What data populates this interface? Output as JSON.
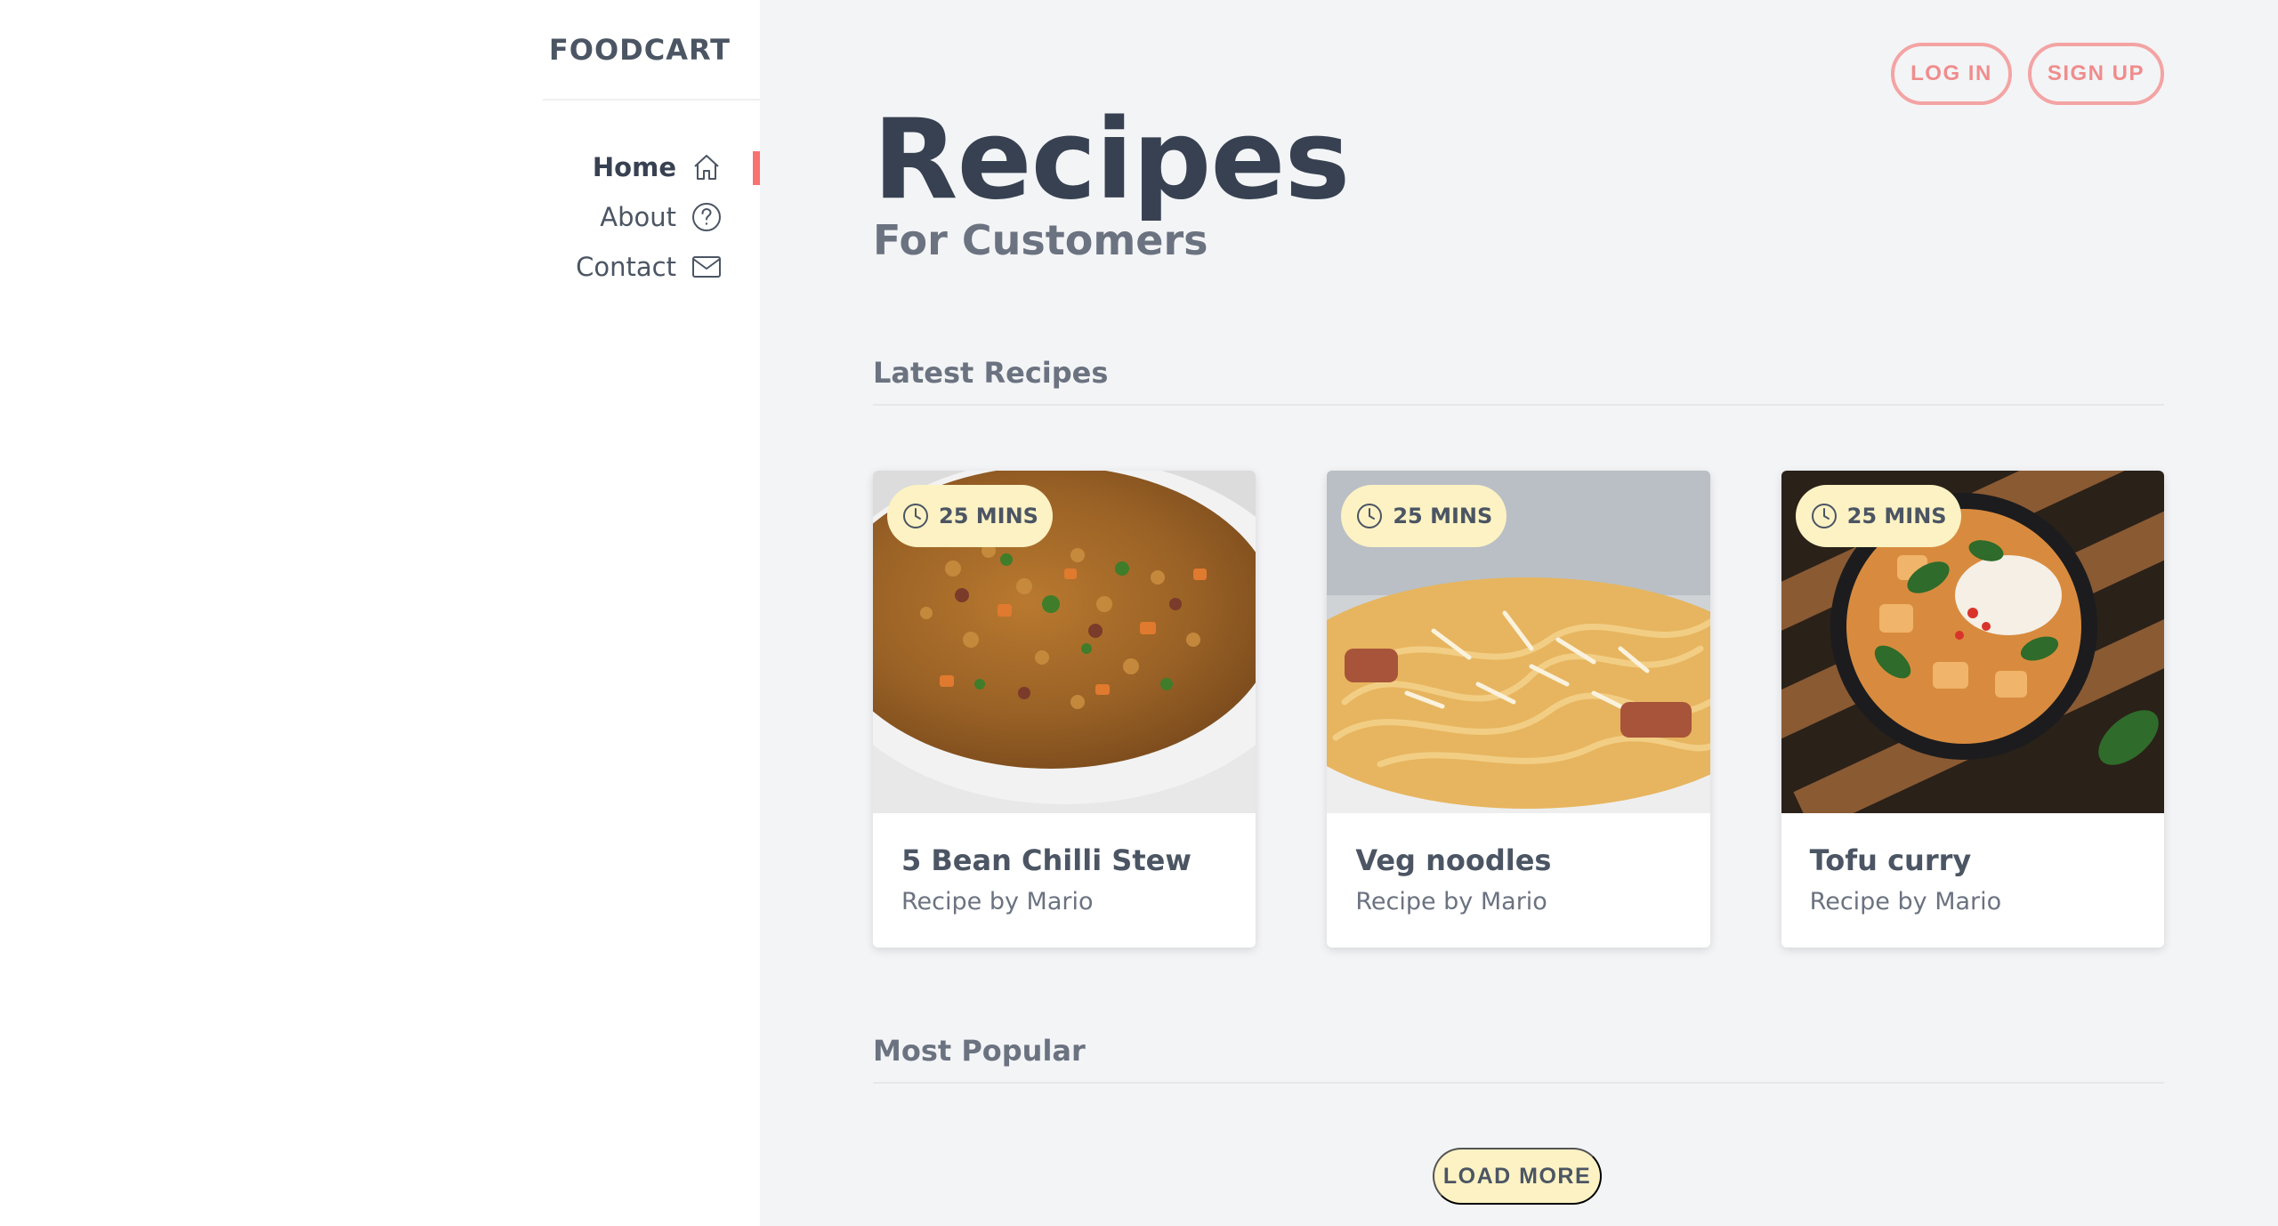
{
  "brand": "FOODCART",
  "nav": [
    {
      "label": "Home",
      "icon": "home-icon",
      "active": true
    },
    {
      "label": "About",
      "icon": "question-circle-icon",
      "active": false
    },
    {
      "label": "Contact",
      "icon": "mail-icon",
      "active": false
    }
  ],
  "auth": {
    "login": "LOG IN",
    "signup": "SIGN UP"
  },
  "header": {
    "title": "Recipes",
    "subtitle": "For Customers"
  },
  "sections": {
    "latest": "Latest Recipes",
    "popular": "Most Popular"
  },
  "recipes": [
    {
      "time": "25 MINS",
      "title": "5 Bean Chilli Stew",
      "author": "Recipe by Mario",
      "image": "bean-stew-photo"
    },
    {
      "time": "25 MINS",
      "title": "Veg noodles",
      "author": "Recipe by Mario",
      "image": "noodles-photo"
    },
    {
      "time": "25 MINS",
      "title": "Tofu curry",
      "author": "Recipe by Mario",
      "image": "tofu-curry-photo"
    }
  ],
  "load_more": "LOAD MORE",
  "colors": {
    "accent": "#f87171",
    "badge": "#fdf2c4",
    "background": "#f3f4f6"
  }
}
